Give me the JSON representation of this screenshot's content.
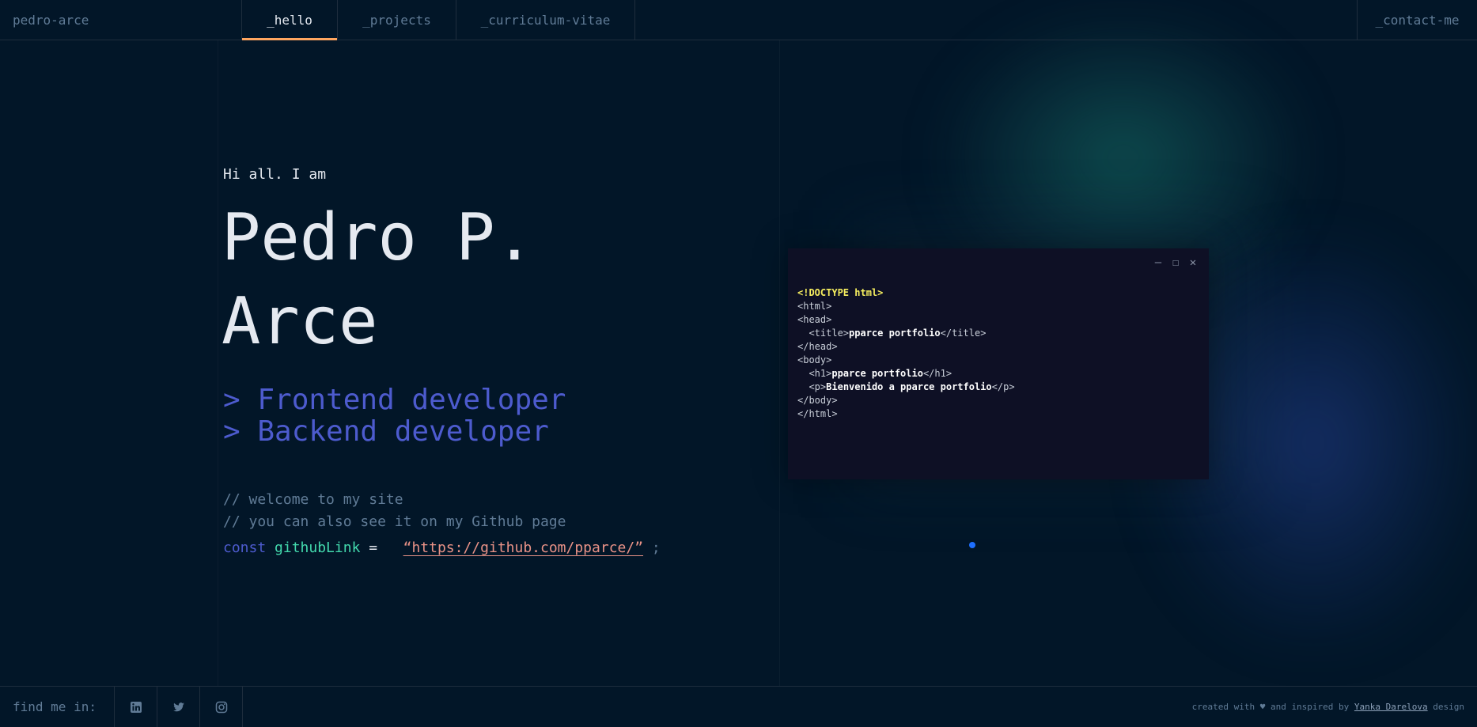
{
  "header": {
    "brand": "pedro-arce",
    "tabs": [
      {
        "label": "_hello",
        "active": true
      },
      {
        "label": "_projects",
        "active": false
      },
      {
        "label": "_curriculum-vitae",
        "active": false
      }
    ],
    "contact": "_contact-me"
  },
  "hero": {
    "greeting": "Hi all. I am",
    "name": "Pedro P. Arce",
    "roles": [
      "> Frontend developer",
      "> Backend developer"
    ],
    "comments": [
      "// welcome to my site",
      "// you can also see it on my Github page"
    ],
    "code": {
      "keyword": "const",
      "variable": "githubLink",
      "operator": "=",
      "link": "“https://github.com/pparce/”",
      "terminator": ";"
    }
  },
  "code_window": {
    "controls": [
      "–",
      "☐",
      "✕"
    ],
    "lines": {
      "doctype": "<!DOCTYPE html>",
      "html_open": "<html>",
      "head_open": "<head>",
      "title_open": "<title>",
      "title_text": "pparce portfolio",
      "title_close": "</title>",
      "head_close": "</head>",
      "body_open": "<body>",
      "h1_open": "<h1>",
      "h1_text": "pparce portfolio",
      "h1_close": "</h1>",
      "p_open": "<p>",
      "p_text": "Bienvenido a pparce portfolio",
      "p_close": "</p>",
      "body_close": "</body>",
      "html_close": "</html>"
    }
  },
  "footer": {
    "find_me": "find me in:",
    "social": [
      {
        "icon": "linkedin-icon"
      },
      {
        "icon": "twitter-icon"
      },
      {
        "icon": "instagram-icon"
      }
    ],
    "credits_prefix": "created with ♥ and inspired by ",
    "credits_link": "Yanka Darelova",
    "credits_suffix": " design"
  },
  "colors": {
    "background": "#021628",
    "accent": "#FEA55F",
    "role_blue": "#4D5BCE",
    "variable_green": "#43D9AD",
    "string_pink": "#E99287",
    "doctype_yellow": "#F6EE5F"
  }
}
